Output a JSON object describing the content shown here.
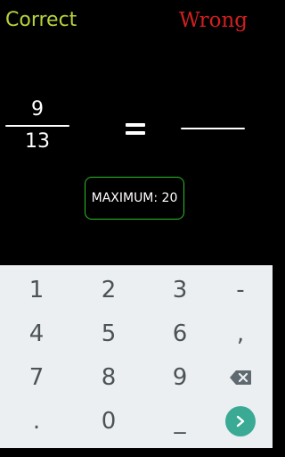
{
  "header": {
    "correct_label": "Correct",
    "wrong_label": "Wrong"
  },
  "problem": {
    "numerator": "9",
    "denominator": "13",
    "equals": "=",
    "answer": ""
  },
  "maximum_label": "MAXIMUM: 20",
  "keyboard": {
    "rows": [
      [
        "1",
        "2",
        "3",
        "-"
      ],
      [
        "4",
        "5",
        "6",
        ","
      ],
      [
        "7",
        "8",
        "9",
        "backspace-icon"
      ],
      [
        ".",
        "0",
        "_",
        "enter-icon"
      ]
    ]
  },
  "colors": {
    "correct": "#b7d33a",
    "wrong": "#d11f1f",
    "max_border": "#2bc02b",
    "enter_key": "#3aaa95",
    "keyboard_bg": "#eceff1"
  }
}
